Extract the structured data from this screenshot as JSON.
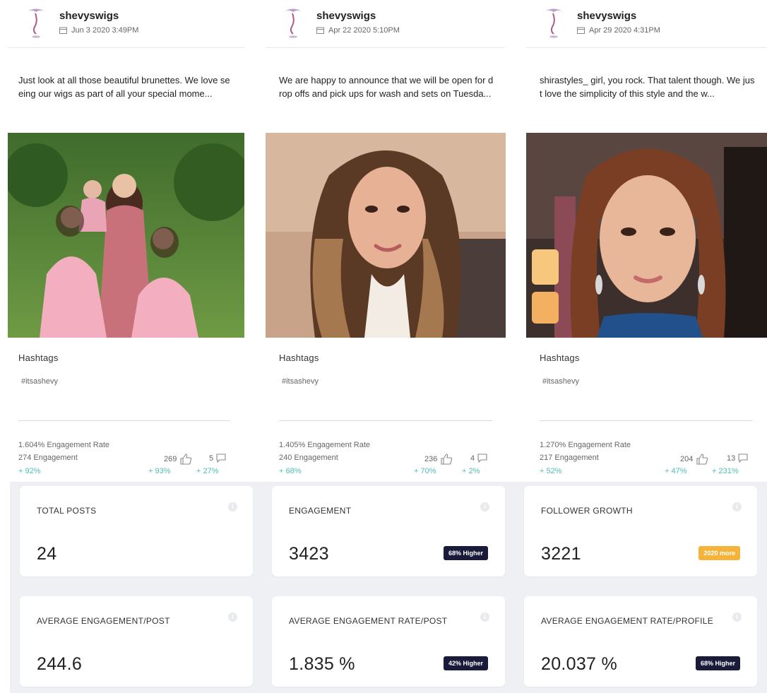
{
  "posts": [
    {
      "author": "shevyswigs",
      "date": "Jun 3 2020 3:49PM",
      "caption": "Just look at all those beautiful brunettes. We love seeing our wigs as part of all your special mome...",
      "hashtags_title": "Hashtags",
      "hashtag": "#itsashevy",
      "engagement_rate": "1.604% Engagement Rate",
      "engagement": "274 Engagement",
      "likes": "269",
      "comments": "5",
      "growth_engagement": "+ 92%",
      "growth_likes": "+ 93%",
      "growth_comments": "+ 27%"
    },
    {
      "author": "shevyswigs",
      "date": "Apr 22 2020 5:10PM",
      "caption": "We are happy to announce that we will be open for drop offs and pick ups for wash and sets on Tuesda...",
      "hashtags_title": "Hashtags",
      "hashtag": "#itsashevy",
      "engagement_rate": "1.405% Engagement Rate",
      "engagement": "240 Engagement",
      "likes": "236",
      "comments": "4",
      "growth_engagement": "+ 68%",
      "growth_likes": "+ 70%",
      "growth_comments": "+ 2%"
    },
    {
      "author": "shevyswigs",
      "date": "Apr 29 2020 4:31PM",
      "caption": "shirastyles_ girl, you rock. That talent though. We just love the simplicity of this style and the w...",
      "hashtags_title": "Hashtags",
      "hashtag": "#itsashevy",
      "engagement_rate": "1.270% Engagement Rate",
      "engagement": "217 Engagement",
      "likes": "204",
      "comments": "13",
      "growth_engagement": "+ 52%",
      "growth_likes": "+ 47%",
      "growth_comments": "+ 231%"
    }
  ],
  "cards": [
    {
      "title": "TOTAL POSTS",
      "value": "24",
      "badge": ""
    },
    {
      "title": "ENGAGEMENT",
      "value": "3423",
      "badge": "68% Higher"
    },
    {
      "title": "FOLLOWER GROWTH",
      "value": "3221",
      "badge": "2020 more"
    },
    {
      "title": "AVERAGE ENGAGEMENT/POST",
      "value": "244.6",
      "badge": ""
    },
    {
      "title": "AVERAGE ENGAGEMENT RATE/POST",
      "value": "1.835 %",
      "badge": "42% Higher"
    },
    {
      "title": "AVERAGE ENGAGEMENT RATE/PROFILE",
      "value": "20.037 %",
      "badge": "68% Higher"
    }
  ],
  "colors": {
    "growth": "#4fbdb4",
    "badge_dark": "#1a1a3a",
    "badge_orange": "#f6b33a",
    "dashboard_bg": "#eef0f4"
  },
  "icons": [
    "logo-icon",
    "calendar-icon",
    "like-icon",
    "comment-icon",
    "info-icon"
  ]
}
